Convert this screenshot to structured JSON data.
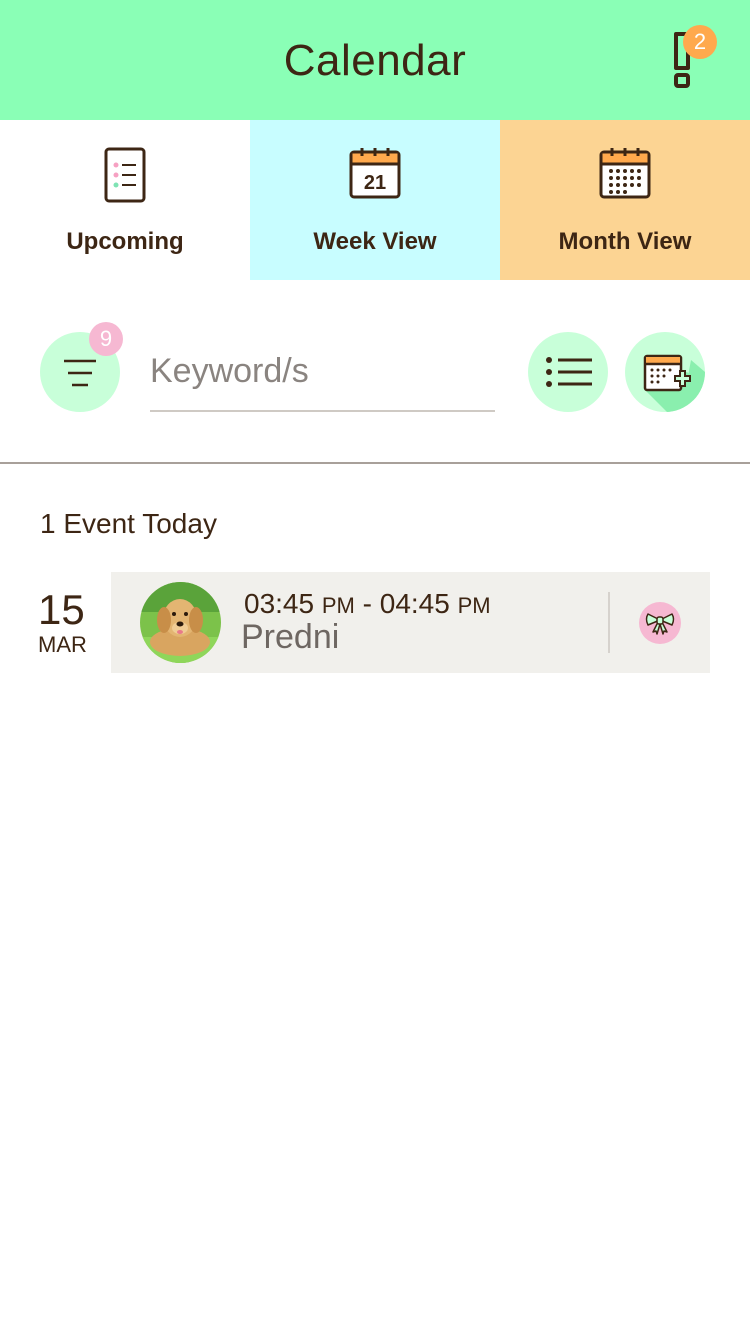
{
  "header": {
    "title": "Calendar",
    "alert_count": "2",
    "background": "#8affb6"
  },
  "tabs": [
    {
      "label": "Upcoming",
      "icon": "list-document-icon",
      "color": "#ffffff"
    },
    {
      "label": "Week View",
      "icon": "calendar-day-icon",
      "day": "21",
      "color": "#c8fdff"
    },
    {
      "label": "Month View",
      "icon": "calendar-month-icon",
      "color": "#fcd493"
    }
  ],
  "search": {
    "placeholder": "Keyword/s",
    "value": "",
    "filter_count": "9"
  },
  "events_section": {
    "heading": "1 Event Today",
    "groups": [
      {
        "day": "15",
        "month": "MAR",
        "events": [
          {
            "start_time": "03:45",
            "start_ampm": "PM",
            "separator": " - ",
            "end_time": "04:45",
            "end_ampm": "PM",
            "name": "Predni",
            "avatar": "dog-photo",
            "tag_icon": "bow-icon"
          }
        ]
      }
    ]
  },
  "colors": {
    "accent_green": "#c8ffd9",
    "badge_orange": "#ffa94d",
    "badge_pink": "#f6b8d2",
    "text_brown": "#3d2614"
  }
}
